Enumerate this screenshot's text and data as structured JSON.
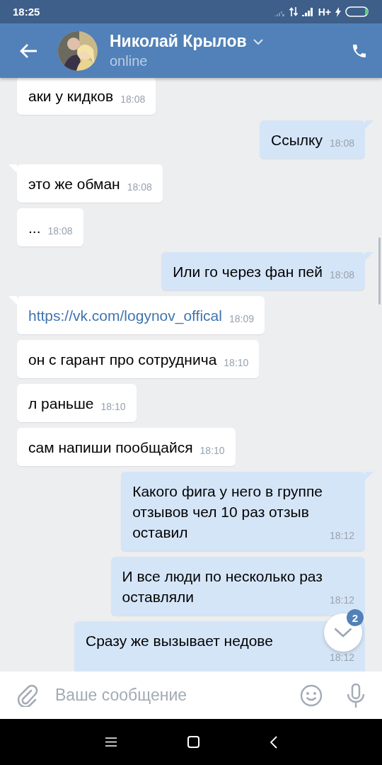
{
  "status_bar": {
    "time": "18:25",
    "network": "H+"
  },
  "header": {
    "name": "Николай Крылов",
    "status": "online"
  },
  "messages": [
    {
      "outgoing": false,
      "tail": false,
      "kind": "text",
      "text": "аки у кидков",
      "time": "18:08"
    },
    {
      "outgoing": true,
      "tail": true,
      "kind": "text",
      "text": "Ссылку",
      "time": "18:08"
    },
    {
      "outgoing": false,
      "tail": true,
      "kind": "text",
      "text": "это же обман",
      "time": "18:08"
    },
    {
      "outgoing": false,
      "tail": false,
      "kind": "text",
      "text": "...",
      "time": "18:08"
    },
    {
      "outgoing": true,
      "tail": true,
      "kind": "text",
      "text": "Или го через фан пей",
      "time": "18:08"
    },
    {
      "outgoing": false,
      "tail": true,
      "kind": "link",
      "text": "https://vk.com/logynov_offical",
      "time": "18:09"
    },
    {
      "outgoing": false,
      "tail": false,
      "kind": "text",
      "text": "он с гарант про сотруднича",
      "time": "18:10"
    },
    {
      "outgoing": false,
      "tail": false,
      "kind": "text",
      "text": "л раньше",
      "time": "18:10"
    },
    {
      "outgoing": false,
      "tail": false,
      "kind": "text",
      "text": "сам напиши пообщайся",
      "time": "18:10"
    },
    {
      "outgoing": true,
      "tail": true,
      "kind": "text",
      "text": "Какого фига у него в группе\nотзывов чел 10 раз отзыв\nоставил",
      "time": "18:12"
    },
    {
      "outgoing": true,
      "tail": false,
      "kind": "text",
      "text": "И все люди по несколько раз\nоставляли",
      "time": "18:12"
    },
    {
      "outgoing": true,
      "tail": false,
      "kind": "text",
      "text": "Сразу же вызывает недове",
      "time": "18:12"
    }
  ],
  "scroll_button": {
    "badge": "2"
  },
  "composer": {
    "placeholder": "Ваше сообщение"
  }
}
